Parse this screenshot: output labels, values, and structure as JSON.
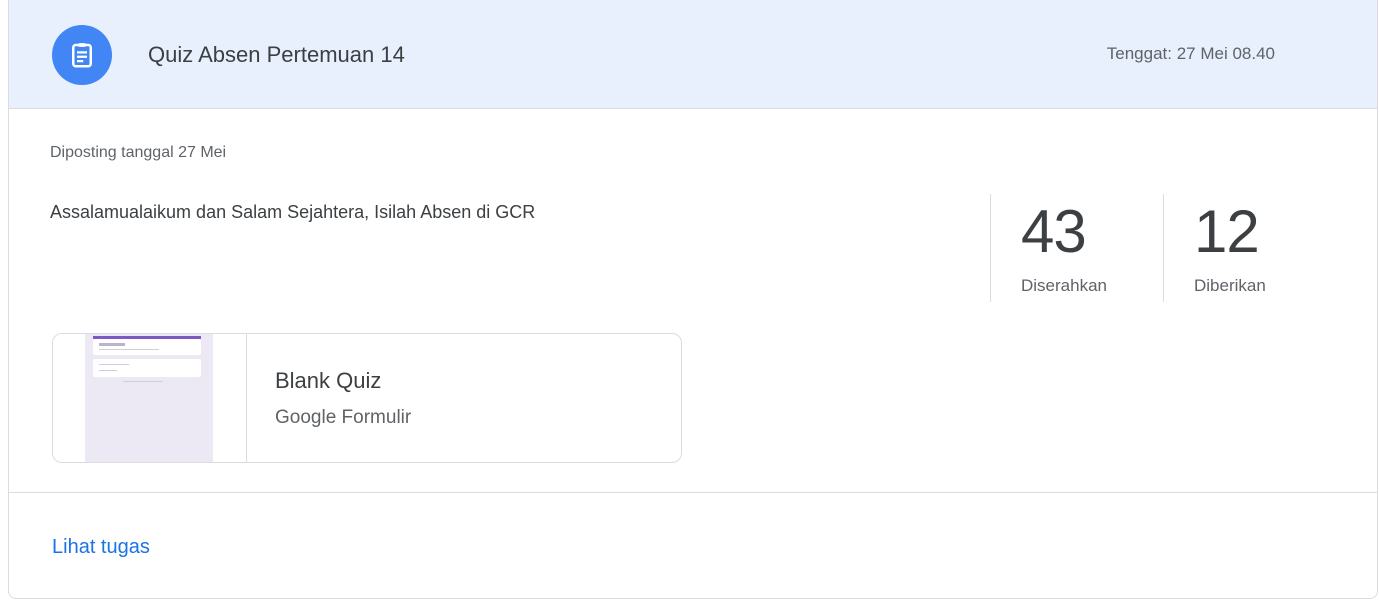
{
  "assignment": {
    "icon": "assignment-icon",
    "title": "Quiz Absen Pertemuan 14",
    "due": "Tenggat: 27 Mei 08.40",
    "posted": "Diposting tanggal 27 Mei",
    "instructions": "Assalamualaikum dan Salam Sejahtera, Isilah Absen di GCR"
  },
  "stats": [
    {
      "value": "43",
      "label": "Diserahkan"
    },
    {
      "value": "12",
      "label": "Diberikan"
    }
  ],
  "attachment": {
    "title": "Blank Quiz",
    "type": "Google Formulir",
    "thumbnail": "google-form-thumbnail"
  },
  "footer": {
    "link_label": "Lihat tugas"
  },
  "colors": {
    "header_bg": "#e8f0fe",
    "icon_bg": "#4285f4",
    "link": "#1a73e8",
    "form_thumb_bg": "#ece9f4"
  }
}
